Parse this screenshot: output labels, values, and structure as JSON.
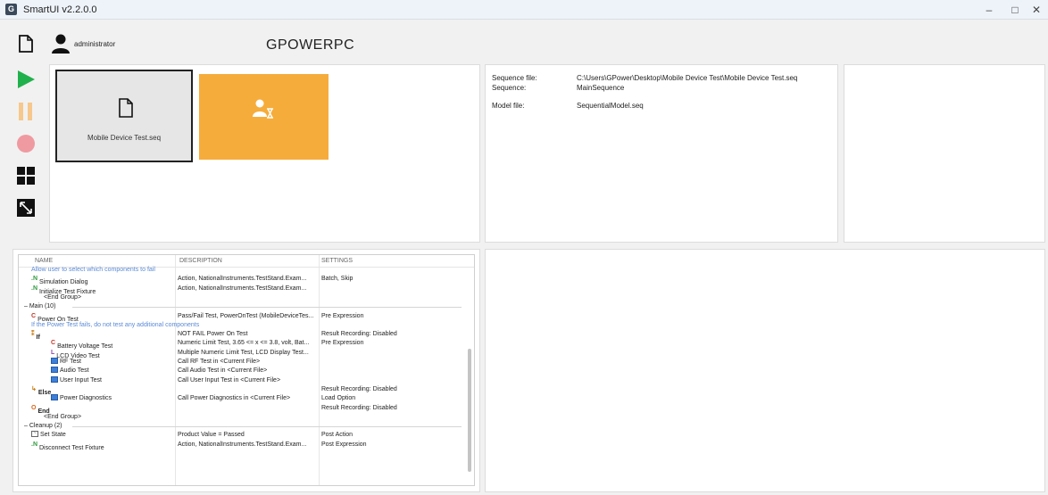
{
  "window": {
    "title": "SmartUI v2.2.0.0",
    "app_icon_letter": "G",
    "minimize": "–",
    "maximize": "□",
    "close": "✕"
  },
  "header": {
    "user": "administrator",
    "computer": "GPOWERPC"
  },
  "sidebar": {
    "icons": [
      "new-file-icon",
      "run-icon",
      "pause-icon",
      "stop-icon",
      "dashboard-icon",
      "resize-icon"
    ]
  },
  "tiles": {
    "file_label": "Mobile Device Test.seq",
    "user_tile_icon": "user-waiting-icon"
  },
  "info": {
    "sequence_file_label": "Sequence file:",
    "sequence_file_value": "C:\\Users\\GPower\\Desktop\\Mobile Device Test\\Mobile Device Test.seq",
    "sequence_label": "Sequence:",
    "sequence_value": "MainSequence",
    "model_file_label": "Model file:",
    "model_file_value": "SequentialModel.seq"
  },
  "grid": {
    "columns": [
      "NAME",
      "DESCRIPTION",
      "SETTINGS"
    ],
    "rows": [
      {
        "kind": "comment",
        "name": "Allow user to select which components to fail",
        "desc": "",
        "settings": ""
      },
      {
        "kind": "step",
        "icon": "N",
        "name": "Simulation Dialog",
        "desc": "Action,  NationalInstruments.TestStand.Exam...",
        "settings": "Batch, Skip"
      },
      {
        "kind": "step",
        "icon": "N",
        "name": "Initialize Test Fixture",
        "desc": "Action,  NationalInstruments.TestStand.Exam...",
        "settings": ""
      },
      {
        "kind": "plain",
        "name": "<End Group>",
        "desc": "",
        "settings": ""
      },
      {
        "kind": "group",
        "name": "Main (10)",
        "desc": "",
        "settings": ""
      },
      {
        "kind": "step",
        "icon": "C",
        "name": "Power On Test",
        "desc": "Pass/Fail Test,  PowerOnTest (MobileDeviceTes...",
        "settings": "Pre Expression"
      },
      {
        "kind": "comment",
        "name": "If the Power Test fails, do not test any additional components",
        "desc": "",
        "settings": ""
      },
      {
        "kind": "step",
        "icon": "IF",
        "name": "If",
        "desc": "NOT FAIL Power On Test",
        "settings": "Result Recording: Disabled"
      },
      {
        "kind": "step",
        "icon": "C",
        "name": "Battery Voltage Test",
        "desc": "Numeric Limit Test,  3.65 <= x <= 3.8, volt, Bat...",
        "settings": "Pre Expression"
      },
      {
        "kind": "step",
        "icon": "L",
        "name": "LCD Video Test",
        "desc": "Multiple Numeric Limit Test,  LCD Display Test...",
        "settings": ""
      },
      {
        "kind": "step",
        "icon": "GRID",
        "name": "RF Test",
        "desc": "Call RF Test in <Current File>",
        "settings": ""
      },
      {
        "kind": "step",
        "icon": "GRID",
        "name": "Audio Test",
        "desc": "Call Audio Test in <Current File>",
        "settings": ""
      },
      {
        "kind": "step",
        "icon": "GRID",
        "name": "User Input Test",
        "desc": "Call User Input Test in <Current File>",
        "settings": ""
      },
      {
        "kind": "step",
        "icon": "ELSE",
        "name": "Else",
        "desc": "",
        "settings": "Result Recording: Disabled"
      },
      {
        "kind": "step",
        "icon": "GRID",
        "name": "Power Diagnostics",
        "desc": "Call Power Diagnostics in <Current File>",
        "settings": "Load Option"
      },
      {
        "kind": "step",
        "icon": "END",
        "name": "End",
        "desc": "",
        "settings": "Result Recording: Disabled"
      },
      {
        "kind": "plain",
        "name": "<End Group>",
        "desc": "",
        "settings": ""
      },
      {
        "kind": "group",
        "name": "Cleanup (2)",
        "desc": "",
        "settings": ""
      },
      {
        "kind": "step",
        "icon": "STATE",
        "name": "Set State",
        "desc": "Product Value = Passed",
        "settings": "Post Action"
      },
      {
        "kind": "step",
        "icon": "N",
        "name": "Disconnect Test Fixture",
        "desc": "Action,  NationalInstruments.TestStand.Exam...",
        "settings": "Post Expression"
      }
    ]
  },
  "colors": {
    "run": "#21b14c",
    "pause": "#f6c88c",
    "stop": "#ef9aa0",
    "tile_orange": "#f6ac3b",
    "comment_blue": "#5a8ad6"
  }
}
